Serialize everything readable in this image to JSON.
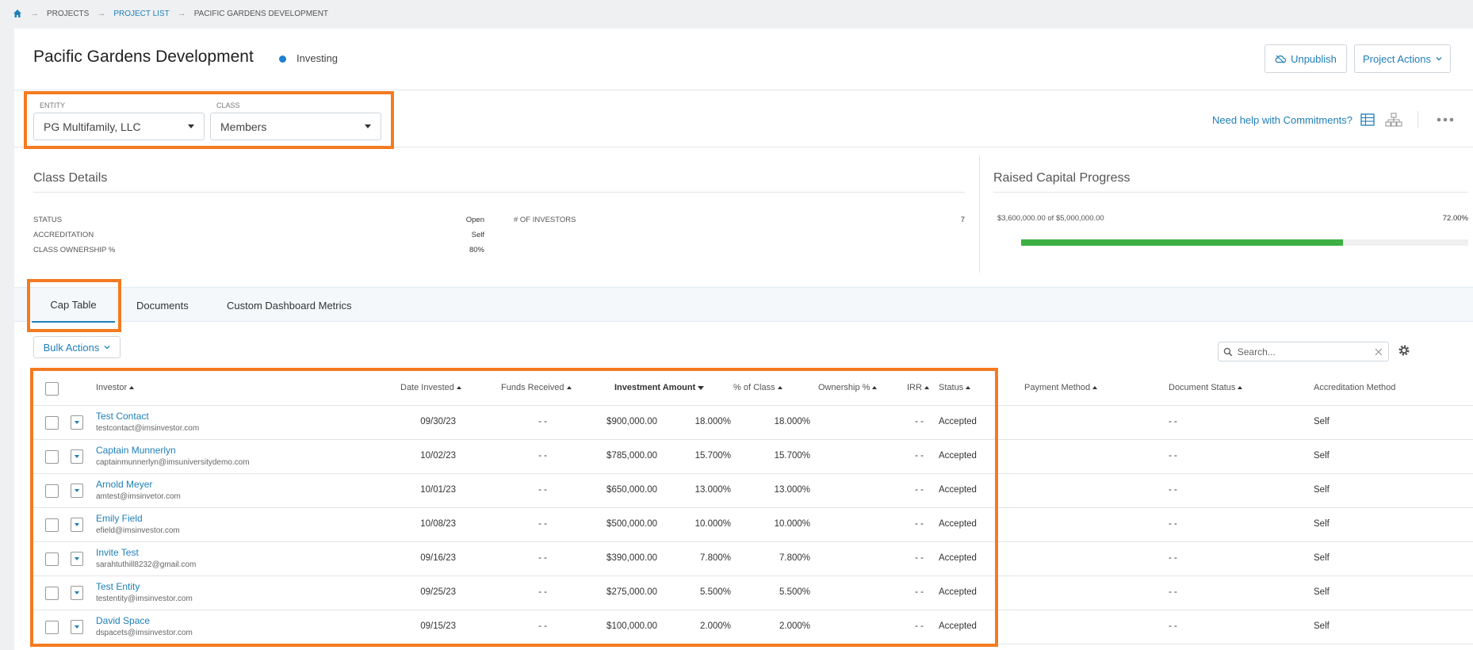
{
  "breadcrumb": [
    "PROJECTS",
    "PROJECT LIST",
    "PACIFIC GARDENS DEVELOPMENT"
  ],
  "header": {
    "title": "Pacific Gardens Development",
    "status": "Investing",
    "status_color": "#1f7fd0",
    "unpublish_label": "Unpublish",
    "actions_label": "Project Actions"
  },
  "filters": {
    "entity_label": "ENTITY",
    "entity_value": "PG Multifamily, LLC",
    "class_label": "CLASS",
    "class_value": "Members",
    "help_link": "Need help with Commitments?"
  },
  "class_details": {
    "title": "Class Details",
    "status_label": "STATUS",
    "status_value": "Open",
    "accreditation_label": "ACCREDITATION",
    "accreditation_value": "Self",
    "ownership_label": "CLASS OWNERSHIP %",
    "ownership_value": "80%",
    "investors_label": "# OF INVESTORS",
    "investors_value": "7"
  },
  "raised_capital": {
    "title": "Raised Capital Progress",
    "text": "$3,600,000.00 of $5,000,000.00",
    "percent_text": "72.00%",
    "progress": 0.72,
    "bar_color": "#3cb043"
  },
  "tabs": [
    "Cap Table",
    "Documents",
    "Custom Dashboard Metrics"
  ],
  "toolbar": {
    "bulk_actions": "Bulk Actions",
    "search_placeholder": "Search..."
  },
  "columns": [
    "Investor",
    "Date Invested",
    "Funds Received",
    "Investment Amount",
    "% of Class",
    "Ownership %",
    "IRR",
    "Status",
    "Payment Method",
    "Document Status",
    "Accreditation Method"
  ],
  "rows": [
    {
      "name": "Test Contact",
      "email": "testcontact@imsinvestor.com",
      "date": "09/30/23",
      "funds": "- -",
      "amount": "$900,000.00",
      "pct_class": "18.000%",
      "ownership": "18.000%",
      "irr": "- -",
      "status": "Accepted",
      "payment": "",
      "doc_status": "- -",
      "accreditation": "Self"
    },
    {
      "name": "Captain Munnerlyn",
      "email": "captainmunnerlyn@imsuniversitydemo.com",
      "date": "10/02/23",
      "funds": "- -",
      "amount": "$785,000.00",
      "pct_class": "15.700%",
      "ownership": "15.700%",
      "irr": "- -",
      "status": "Accepted",
      "payment": "",
      "doc_status": "- -",
      "accreditation": "Self"
    },
    {
      "name": "Arnold Meyer",
      "email": "amtest@imsinvetor.com",
      "date": "10/01/23",
      "funds": "- -",
      "amount": "$650,000.00",
      "pct_class": "13.000%",
      "ownership": "13.000%",
      "irr": "- -",
      "status": "Accepted",
      "payment": "",
      "doc_status": "- -",
      "accreditation": "Self"
    },
    {
      "name": "Emily Field",
      "email": "efield@imsinvestor.com",
      "date": "10/08/23",
      "funds": "- -",
      "amount": "$500,000.00",
      "pct_class": "10.000%",
      "ownership": "10.000%",
      "irr": "- -",
      "status": "Accepted",
      "payment": "",
      "doc_status": "- -",
      "accreditation": "Self"
    },
    {
      "name": "Invite Test",
      "email": "sarahtuthill8232@gmail.com",
      "date": "09/16/23",
      "funds": "- -",
      "amount": "$390,000.00",
      "pct_class": "7.800%",
      "ownership": "7.800%",
      "irr": "- -",
      "status": "Accepted",
      "payment": "",
      "doc_status": "- -",
      "accreditation": "Self"
    },
    {
      "name": "Test Entity",
      "email": "testentity@imsinvestor.com",
      "date": "09/25/23",
      "funds": "- -",
      "amount": "$275,000.00",
      "pct_class": "5.500%",
      "ownership": "5.500%",
      "irr": "- -",
      "status": "Accepted",
      "payment": "",
      "doc_status": "- -",
      "accreditation": "Self"
    },
    {
      "name": "David Space",
      "email": "dspacets@imsinvestor.com",
      "date": "09/15/23",
      "funds": "- -",
      "amount": "$100,000.00",
      "pct_class": "2.000%",
      "ownership": "2.000%",
      "irr": "- -",
      "status": "Accepted",
      "payment": "",
      "doc_status": "- -",
      "accreditation": "Self"
    }
  ],
  "highlight_color": "#f47b20",
  "accent_color": "#1f7fb9"
}
